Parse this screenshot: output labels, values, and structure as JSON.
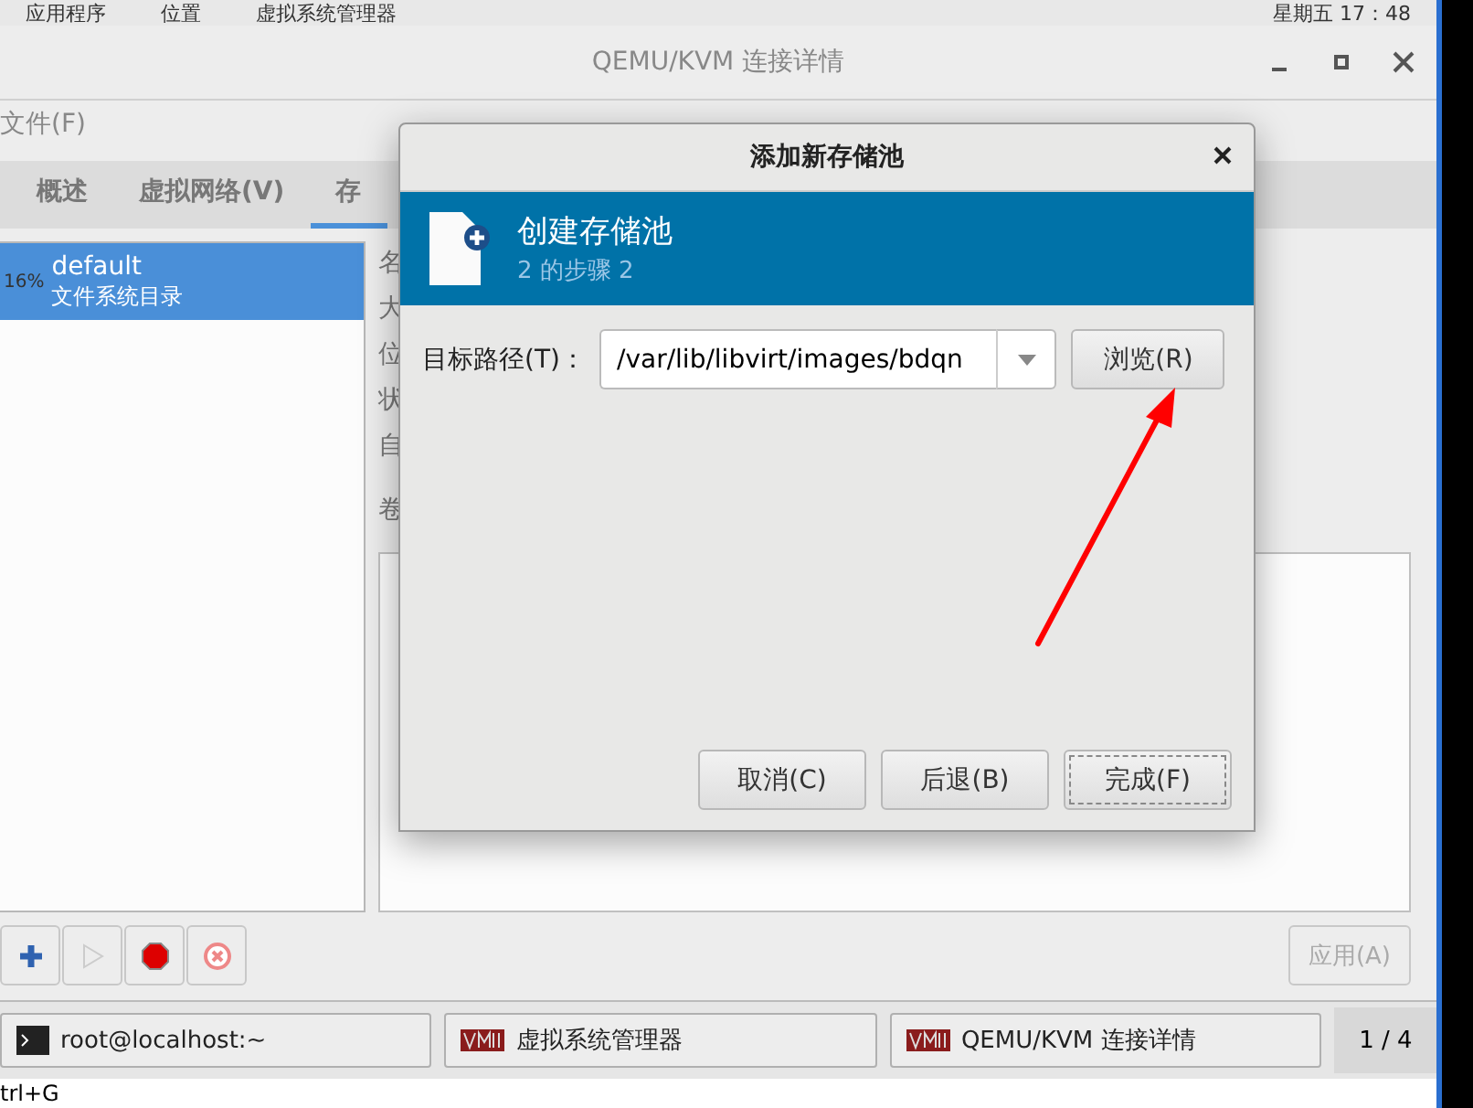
{
  "top_panel": {
    "menus": [
      "应用程序",
      "位置",
      "虚拟系统管理器"
    ],
    "clock": "星期五 17：48"
  },
  "window": {
    "title": "QEMU/KVM 连接详情"
  },
  "menu": [
    "文件(F)"
  ],
  "tabs": [
    {
      "label": "概述",
      "selected": false
    },
    {
      "label": "虚拟网络(V)",
      "selected": false
    },
    {
      "label": "存",
      "selected": true
    }
  ],
  "pools": [
    {
      "usage": "16%",
      "name": "default",
      "type": "文件系统目录",
      "selected": true
    }
  ],
  "detail_labels": [
    "名",
    "大",
    "位",
    "状",
    "自"
  ],
  "volumes_label": "卷",
  "apply_button": {
    "label": "应用(A)",
    "disabled": true
  },
  "dialog": {
    "title": "添加新存储池",
    "header": {
      "title": "创建存储池",
      "step": "2 的步骤 2"
    },
    "target_path": {
      "label": "目标路径(T)：",
      "value": "/var/lib/libvirt/images/bdqn"
    },
    "browse": "浏览(R)",
    "buttons": [
      {
        "label": "取消(C)",
        "focused": false
      },
      {
        "label": "后退(B)",
        "focused": false
      },
      {
        "label": "完成(F)",
        "focused": true
      }
    ]
  },
  "taskbar": {
    "items": [
      {
        "kind": "terminal",
        "label": "root@localhost:~"
      },
      {
        "kind": "vm",
        "label": "虚拟系统管理器"
      },
      {
        "kind": "vm",
        "label": "QEMU/KVM 连接详情"
      }
    ],
    "workspace": "1 / 4"
  },
  "status": "trl+G"
}
